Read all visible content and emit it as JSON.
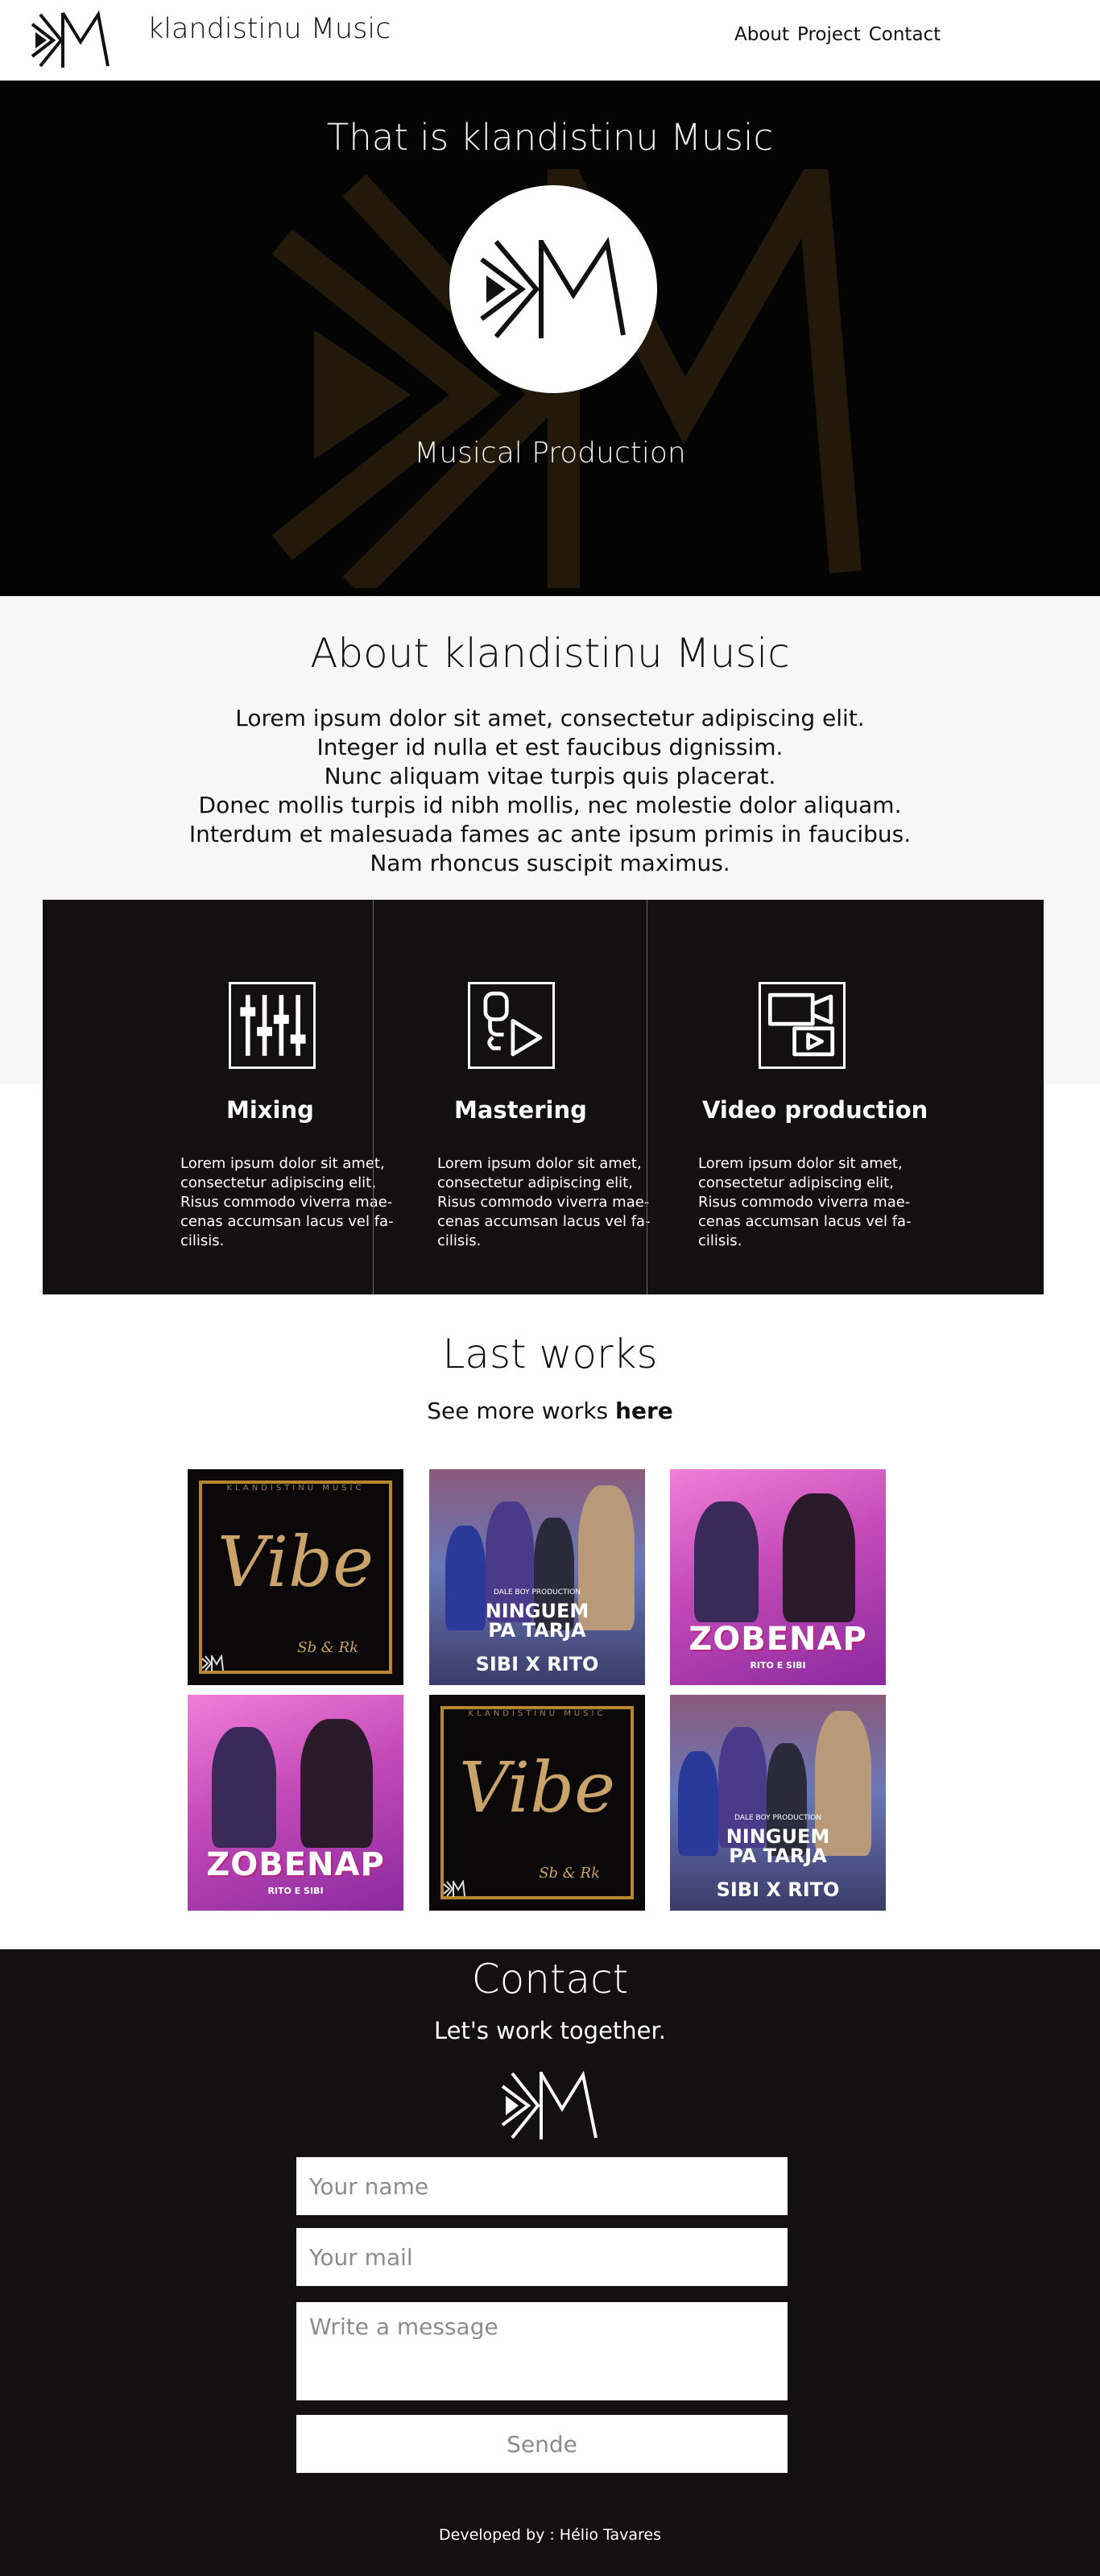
{
  "header": {
    "brand": "klandistinu Music",
    "nav": [
      "About",
      "Project",
      "Contact"
    ]
  },
  "hero": {
    "title": "That is klandistinu Music",
    "subtitle": "Musical Production"
  },
  "about": {
    "title": "About klandistinu Music",
    "lines": [
      "Lorem ipsum dolor sit amet, consectetur adipiscing elit.",
      "Integer id nulla et est faucibus dignissim.",
      "Nunc aliquam vitae turpis quis placerat.",
      "Donec mollis turpis id nibh mollis, nec molestie dolor aliquam.",
      "Interdum et malesuada fames ac ante ipsum primis in faucibus.",
      "Nam rhoncus suscipit maximus."
    ]
  },
  "services": [
    {
      "title": "Mixing",
      "icon": "mixer-sliders-icon",
      "text": [
        "Lorem ipsum dolor sit amet,",
        "consectetur adipiscing elit,",
        "Risus commodo viverra mae-",
        "cenas accumsan lacus vel fa-",
        "cilisis."
      ]
    },
    {
      "title": "Mastering",
      "icon": "mastering-play-icon",
      "text": [
        "Lorem ipsum dolor sit amet,",
        "consectetur adipiscing elit,",
        "Risus commodo viverra mae-",
        "cenas accumsan lacus vel fa-",
        "cilisis."
      ]
    },
    {
      "title": "Video production",
      "icon": "video-camera-icon",
      "text": [
        "Lorem ipsum dolor sit amet,",
        "consectetur adipiscing elit,",
        "Risus commodo viverra mae-",
        "cenas accumsan lacus vel fa-",
        "cilisis."
      ]
    }
  ],
  "works": {
    "title": "Last works",
    "sub_prefix": "See more works",
    "sub_link": "here",
    "covers": [
      {
        "kind": "vibe",
        "word": "Vibe",
        "top": "KLANDISTINU MUSIC",
        "sign": "Sb & Rk"
      },
      {
        "kind": "ninguem",
        "small": "DALE BOY PRODUCTION",
        "line1": "NINGUEM",
        "line2": "PA TARJA",
        "line3": "SIBI X RITO"
      },
      {
        "kind": "zobenap",
        "line1": "ZOBENAP",
        "line2": "RITO E SIBI"
      },
      {
        "kind": "zobenap",
        "line1": "ZOBENAP",
        "line2": "RITO E SIBI"
      },
      {
        "kind": "vibe",
        "word": "Vibe",
        "top": "KLANDISTINU MUSIC",
        "sign": "Sb & Rk"
      },
      {
        "kind": "ninguem",
        "small": "DALE BOY PRODUCTION",
        "line1": "NINGUEM",
        "line2": "PA TARJA",
        "line3": "SIBI X RITO"
      }
    ]
  },
  "contact": {
    "title": "Contact",
    "subtitle": "Let's work together.",
    "name_placeholder": "Your name",
    "mail_placeholder": "Your mail",
    "message_placeholder": "Write a message",
    "send_label": "Sende",
    "credit": "Developed by : Hélio Tavares"
  },
  "colors": {
    "dark": "#141011",
    "hero_bg": "#050404",
    "gold": "#b8862f",
    "light_section": "#f7f7f7"
  }
}
